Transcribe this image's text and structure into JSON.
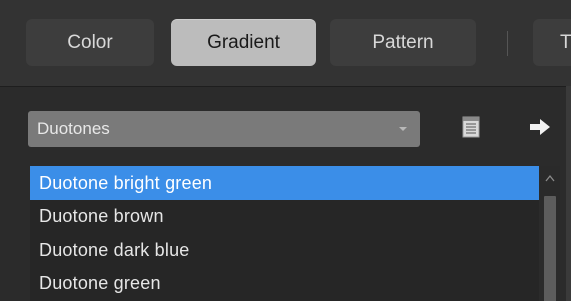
{
  "tabs": [
    {
      "label": "Color"
    },
    {
      "label": "Gradient",
      "active": true
    },
    {
      "label": "Pattern"
    },
    {
      "label": "T"
    }
  ],
  "category": {
    "selected": "Duotones"
  },
  "presets": [
    {
      "label": "Duotone bright green",
      "selected": true
    },
    {
      "label": "Duotone brown"
    },
    {
      "label": "Duotone dark blue"
    },
    {
      "label": "Duotone green"
    }
  ],
  "icons": {
    "list": "list-icon",
    "arrow": "arrow-right-icon",
    "dropdown": "chevron-down-icon",
    "scroll_up": "chevron-up-icon"
  },
  "colors": {
    "selection": "#3b8ee8",
    "active_tab": "#bcbcbc",
    "background": "#2b2b2b"
  }
}
